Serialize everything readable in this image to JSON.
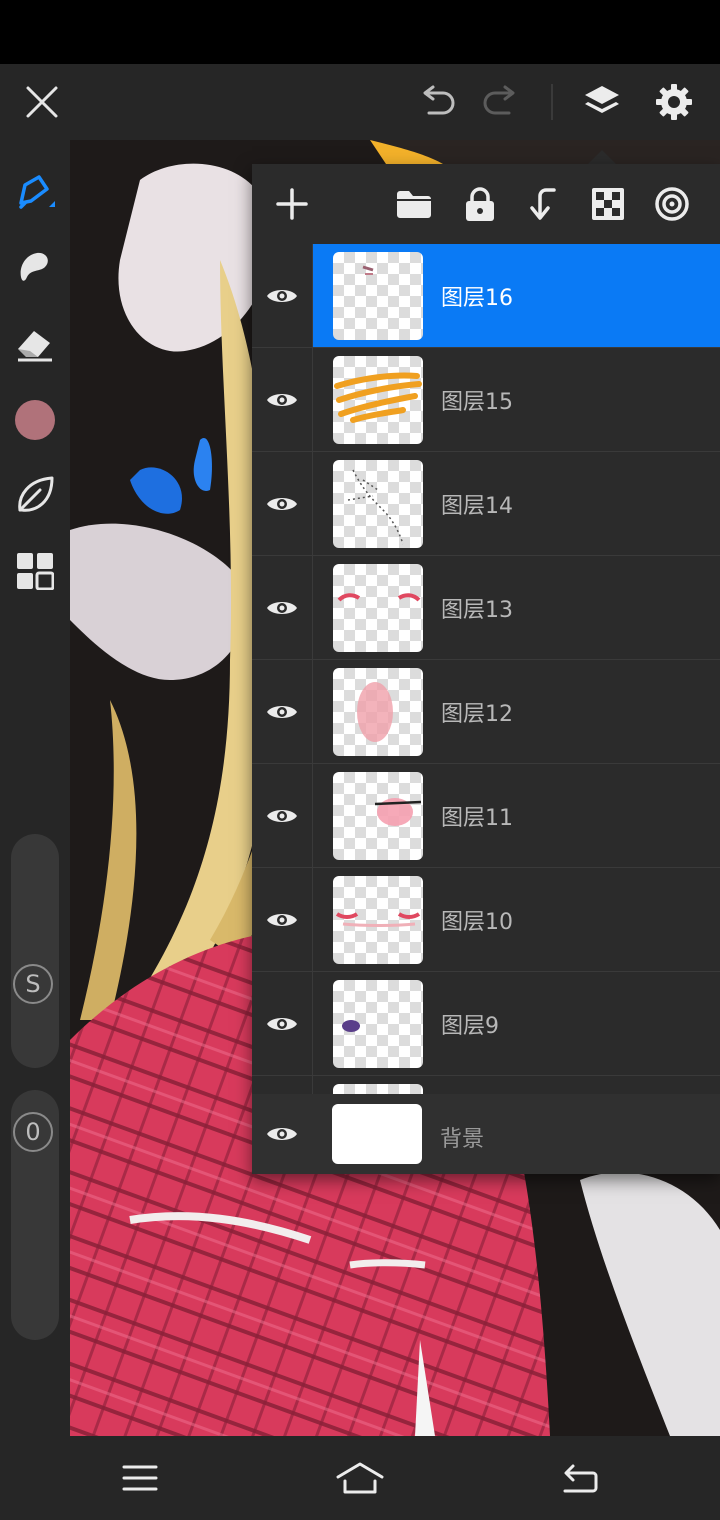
{
  "toolbar": {
    "close_icon": "close-icon",
    "undo_icon": "undo-icon",
    "redo_icon": "redo-icon",
    "layers_icon": "layers-icon",
    "settings_icon": "gear-icon"
  },
  "tools": {
    "items": [
      "brush-icon",
      "smudge-icon",
      "eraser-icon",
      "color-swatch",
      "leaf-icon",
      "grid-icon"
    ],
    "current_color": "#b0727a",
    "accent_color": "#1a8cff",
    "size_slider_label": "S",
    "opacity_slider_label": "0"
  },
  "layer_panel": {
    "toolbar_icons": [
      "add-icon",
      "folder-icon",
      "lock-icon",
      "merge-down-icon",
      "transparency-icon",
      "target-icon"
    ],
    "layers": [
      {
        "name": "图层16",
        "selected": true
      },
      {
        "name": "图层15",
        "selected": false
      },
      {
        "name": "图层14",
        "selected": false
      },
      {
        "name": "图层13",
        "selected": false
      },
      {
        "name": "图层12",
        "selected": false
      },
      {
        "name": "图层11",
        "selected": false
      },
      {
        "name": "图层10",
        "selected": false
      },
      {
        "name": "图层9",
        "selected": false
      }
    ],
    "background_layer": {
      "name": "背景"
    }
  },
  "navigation": {
    "menu_icon": "menu-icon",
    "home_icon": "home-icon",
    "back_icon": "back-icon"
  }
}
